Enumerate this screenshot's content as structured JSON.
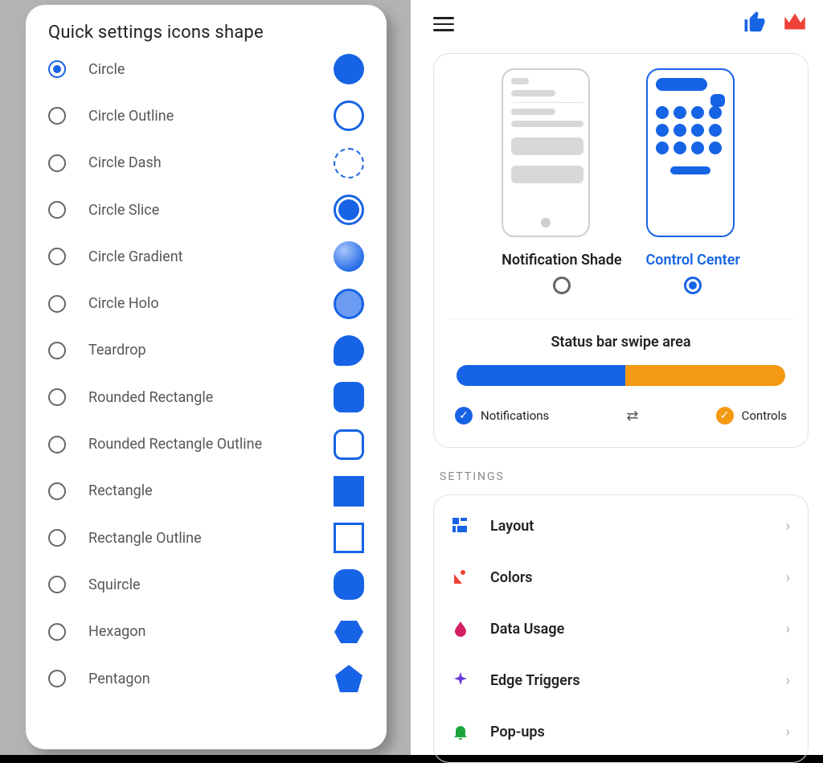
{
  "left": {
    "title": "Quick settings icons shape",
    "options": [
      {
        "label": "Circle",
        "shape": "circle-fill",
        "selected": true
      },
      {
        "label": "Circle Outline",
        "shape": "circle-outline",
        "selected": false
      },
      {
        "label": "Circle Dash",
        "shape": "circle-dash",
        "selected": false
      },
      {
        "label": "Circle Slice",
        "shape": "circle-slice",
        "selected": false
      },
      {
        "label": "Circle Gradient",
        "shape": "circle-gradient",
        "selected": false
      },
      {
        "label": "Circle Holo",
        "shape": "circle-holo",
        "selected": false
      },
      {
        "label": "Teardrop",
        "shape": "teardrop",
        "selected": false
      },
      {
        "label": "Rounded Rectangle",
        "shape": "rrect",
        "selected": false
      },
      {
        "label": "Rounded Rectangle Outline",
        "shape": "rrect-outline",
        "selected": false
      },
      {
        "label": "Rectangle",
        "shape": "rect",
        "selected": false
      },
      {
        "label": "Rectangle Outline",
        "shape": "rect-outline",
        "selected": false
      },
      {
        "label": "Squircle",
        "shape": "squircle",
        "selected": false
      },
      {
        "label": "Hexagon",
        "shape": "hexagon",
        "selected": false
      },
      {
        "label": "Pentagon",
        "shape": "pentagon",
        "selected": false
      }
    ]
  },
  "right": {
    "modes": {
      "notification": {
        "label": "Notification Shade",
        "selected": false
      },
      "control": {
        "label": "Control Center",
        "selected": true
      }
    },
    "swipe_title": "Status bar swipe area",
    "legend": {
      "left": "Notifications",
      "right": "Controls"
    },
    "section_label": "SETTINGS",
    "rows": [
      {
        "label": "Layout",
        "icon": "layout",
        "color": "#1763e5"
      },
      {
        "label": "Colors",
        "icon": "colors",
        "color": "#ef4238"
      },
      {
        "label": "Data Usage",
        "icon": "drop",
        "color": "#d61e62"
      },
      {
        "label": "Edge Triggers",
        "icon": "sparkle",
        "color": "#6a3bd8"
      },
      {
        "label": "Pop-ups",
        "icon": "bell",
        "color": "#1aa63b"
      }
    ]
  }
}
